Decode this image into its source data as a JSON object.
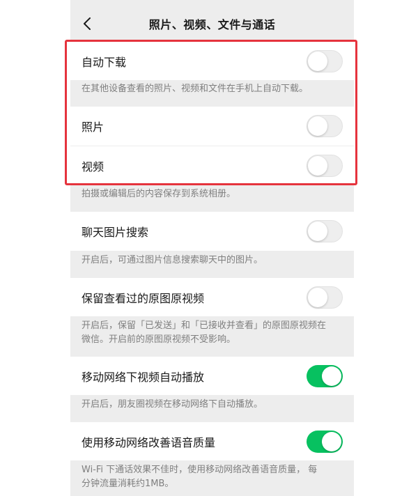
{
  "header": {
    "title": "照片、视频、文件与通话",
    "back_icon": "chevron-left-icon"
  },
  "settings": [
    {
      "label": "自动下载",
      "on": false,
      "desc": "在其他设备查看的照片、视频和文件在手机上自动下载。"
    },
    {
      "label": "照片",
      "on": false
    },
    {
      "label": "视频",
      "on": false,
      "desc": "拍摄或编辑后的内容保存到系统相册。"
    },
    {
      "label": "聊天图片搜索",
      "on": false,
      "desc": "开启后，可通过图片信息搜索聊天中的图片。"
    },
    {
      "label": "保留查看过的原图原视频",
      "on": false,
      "desc_line1": "开启后，保留「已发送」和「已接收并查看」的原图原视频在",
      "desc_line2": "微信。开启前的原图原视频不受影响。"
    },
    {
      "label": "移动网络下视频自动播放",
      "on": true,
      "desc": "开启后，朋友圈视频在移动网络下自动播放。"
    },
    {
      "label": "使用移动网络改善语音质量",
      "on": true,
      "desc_line1": "Wi-Fi 下通话效果不佳时，使用移动网络改善语音质量， 每",
      "desc_line2": "分钟流量消耗约1MB。"
    }
  ],
  "colors": {
    "toggle_on": "#07c160",
    "toggle_off": "#eeeeee",
    "highlight_border": "#e5333d",
    "background": "#ededed"
  }
}
